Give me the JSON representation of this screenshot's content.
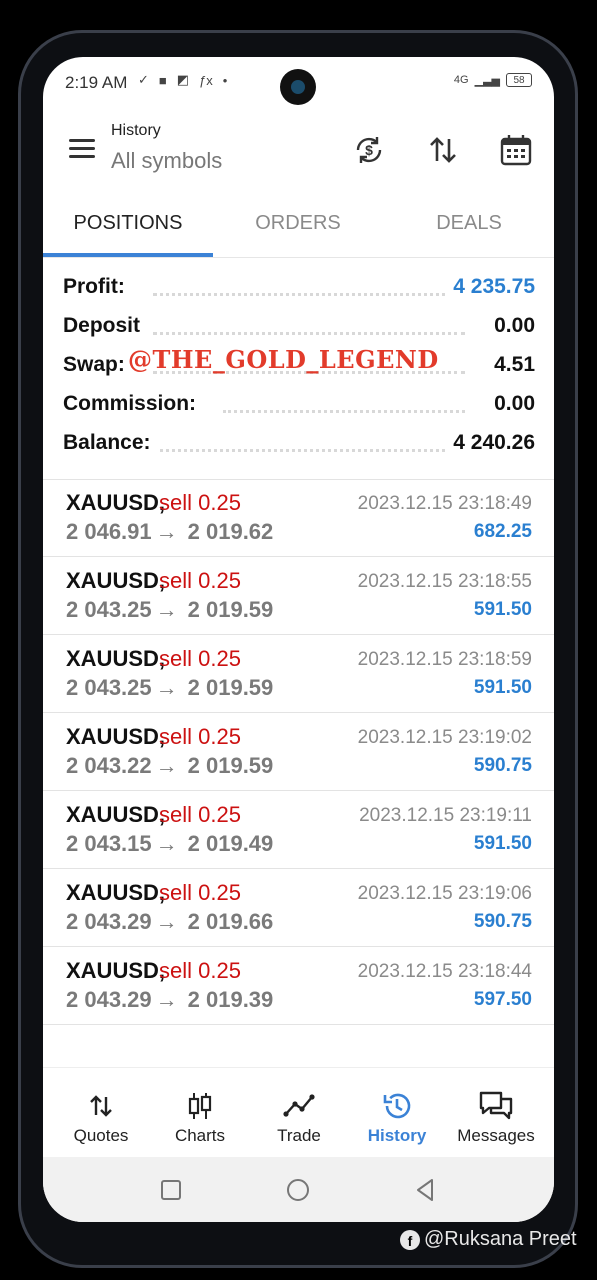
{
  "status_bar": {
    "time": "2:19 AM",
    "network": "4G",
    "battery": "58"
  },
  "header": {
    "title": "History",
    "subtitle": "All symbols"
  },
  "tabs": [
    {
      "label": "POSITIONS",
      "active": true
    },
    {
      "label": "ORDERS",
      "active": false
    },
    {
      "label": "DEALS",
      "active": false
    }
  ],
  "summary": {
    "profit_label": "Profit:",
    "profit_value": "4 235.75",
    "deposit_label": "Deposit",
    "deposit_value": "0.00",
    "swap_label": "Swap:",
    "swap_value": "4.51",
    "commission_label": "Commission:",
    "commission_value": "0.00",
    "balance_label": "Balance:",
    "balance_value": "4 240.26",
    "watermark": "@THE_GOLD_LEGEND"
  },
  "deals": [
    {
      "symbol": "XAUUSD,",
      "side": "sell 0.25",
      "open": "2 046.91",
      "arrow": "→",
      "close": "2 019.62",
      "time": "2023.12.15 23:18:49",
      "profit": "682.25"
    },
    {
      "symbol": "XAUUSD,",
      "side": "sell 0.25",
      "open": "2 043.25",
      "arrow": "→",
      "close": "2 019.59",
      "time": "2023.12.15 23:18:55",
      "profit": "591.50"
    },
    {
      "symbol": "XAUUSD,",
      "side": "sell 0.25",
      "open": "2 043.25",
      "arrow": "→",
      "close": "2 019.59",
      "time": "2023.12.15 23:18:59",
      "profit": "591.50"
    },
    {
      "symbol": "XAUUSD,",
      "side": "sell 0.25",
      "open": "2 043.22",
      "arrow": "→",
      "close": "2 019.59",
      "time": "2023.12.15 23:19:02",
      "profit": "590.75"
    },
    {
      "symbol": "XAUUSD,",
      "side": "sell 0.25",
      "open": "2 043.15",
      "arrow": "→",
      "close": "2 019.49",
      "time": "2023.12.15 23:19:11",
      "profit": "591.50"
    },
    {
      "symbol": "XAUUSD,",
      "side": "sell 0.25",
      "open": "2 043.29",
      "arrow": "→",
      "close": "2 019.66",
      "time": "2023.12.15 23:19:06",
      "profit": "590.75"
    },
    {
      "symbol": "XAUUSD,",
      "side": "sell 0.25",
      "open": "2 043.29",
      "arrow": "→",
      "close": "2 019.39",
      "time": "2023.12.15 23:18:44",
      "profit": "597.50"
    }
  ],
  "bottom_nav": [
    {
      "label": "Quotes",
      "icon": "quotes-icon",
      "active": false
    },
    {
      "label": "Charts",
      "icon": "charts-icon",
      "active": false
    },
    {
      "label": "Trade",
      "icon": "trade-icon",
      "active": false
    },
    {
      "label": "History",
      "icon": "history-icon",
      "active": true
    },
    {
      "label": "Messages",
      "icon": "messages-icon",
      "active": false
    }
  ],
  "credit": {
    "text": "@Ruksana Preet",
    "fb": "f"
  },
  "colors": {
    "accent": "#3b82d6",
    "profit_blue": "#2a7fd0",
    "sell_red": "#cc1111",
    "watermark_red": "#e23b2b"
  }
}
